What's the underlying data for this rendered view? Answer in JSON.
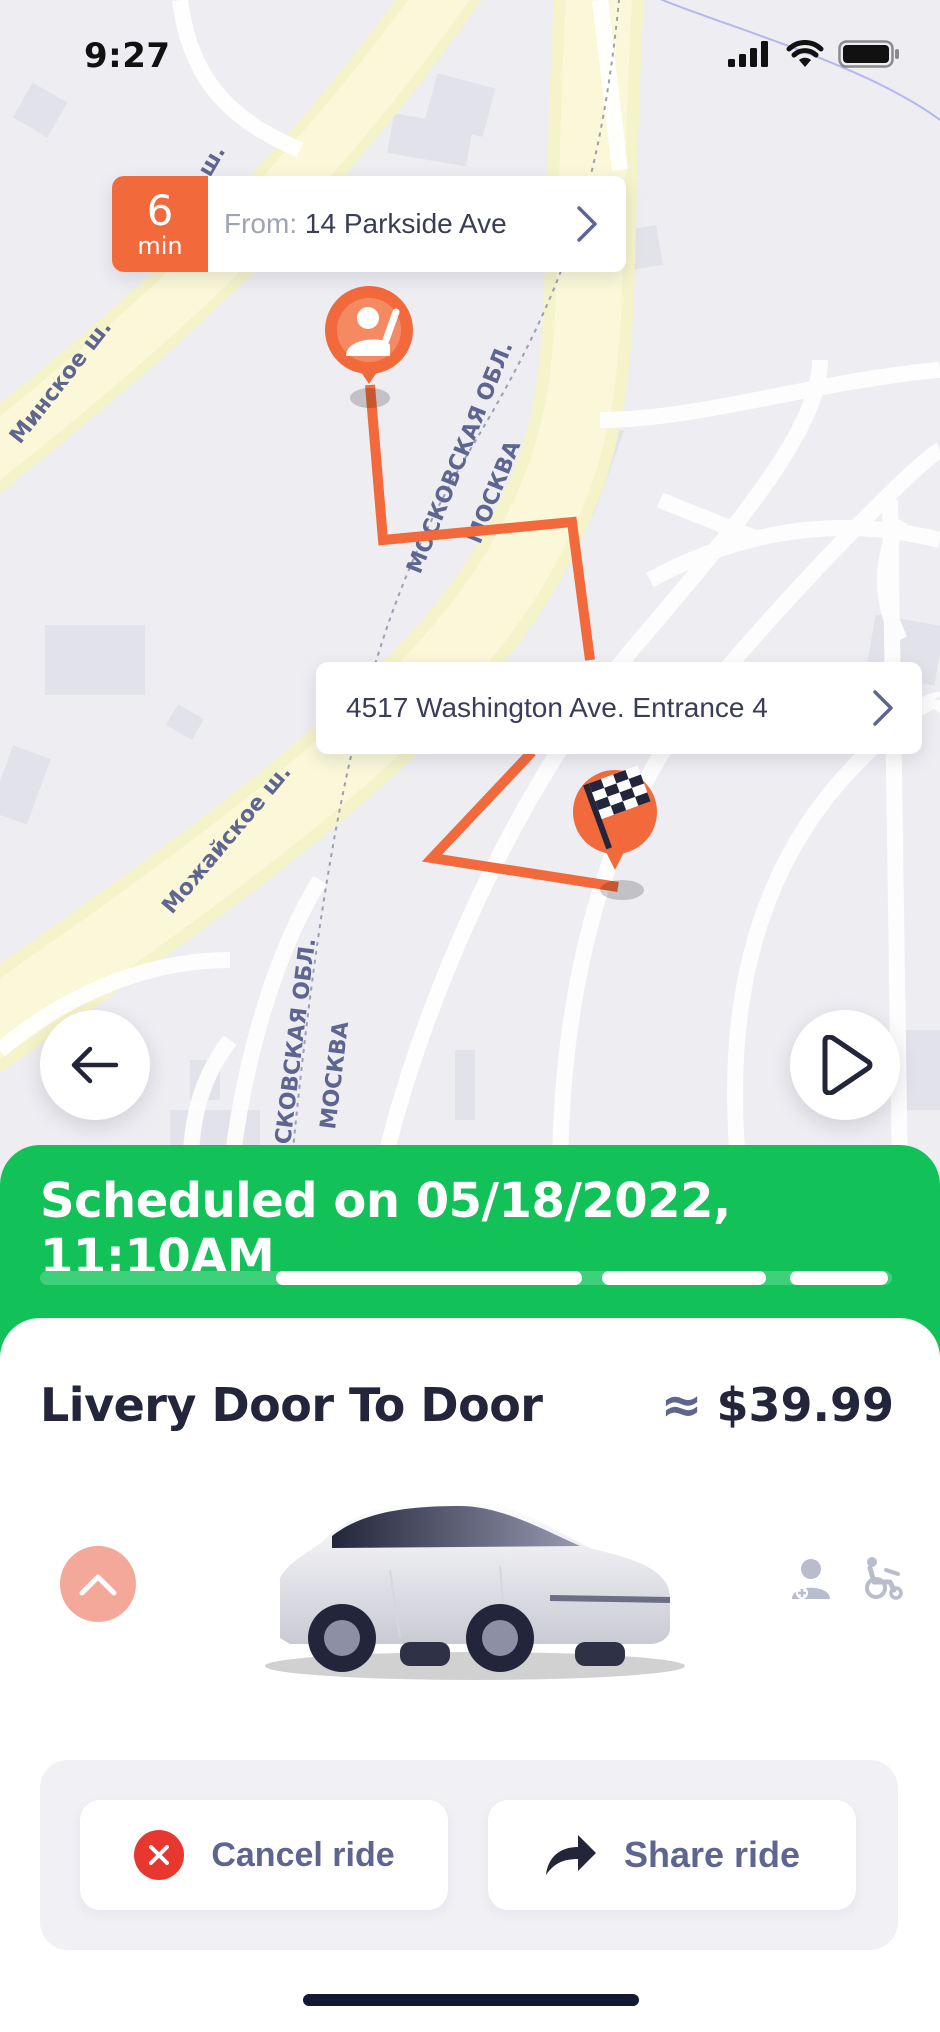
{
  "status_bar": {
    "time": "9:27"
  },
  "map": {
    "street_labels": [
      "Минское ш.",
      "МОСКОВСКАЯ ОБЛ.",
      "МОСКВА",
      "Можайское ш.",
      "СКОВСКАЯ ОБЛ.",
      "МОСКВА",
      "ш."
    ],
    "pickup": {
      "eta_value": "6",
      "eta_unit": "min",
      "prefix": "From:",
      "address": "14 Parkside Ave"
    },
    "destination": {
      "address": "4517 Washington Ave. Entrance 4"
    },
    "route_color": "#f26a3b"
  },
  "schedule": {
    "text": "Scheduled on 05/18/2022, 11:10AM",
    "color": "#12c157"
  },
  "ride": {
    "service_name": "Livery Door To Door",
    "approx_symbol": "≈",
    "price": "$39.99"
  },
  "actions": {
    "cancel_label": "Cancel ride",
    "share_label": "Share ride"
  },
  "icons": [
    "signal-icon",
    "wifi-icon",
    "battery-icon",
    "chevron-right-icon",
    "passenger-pin-icon",
    "checkered-flag-pin-icon",
    "arrow-left-icon",
    "play-icon",
    "chevron-up-icon",
    "car-image",
    "nurse-icon",
    "wheelchair-icon",
    "close-icon",
    "share-arrow-icon"
  ]
}
